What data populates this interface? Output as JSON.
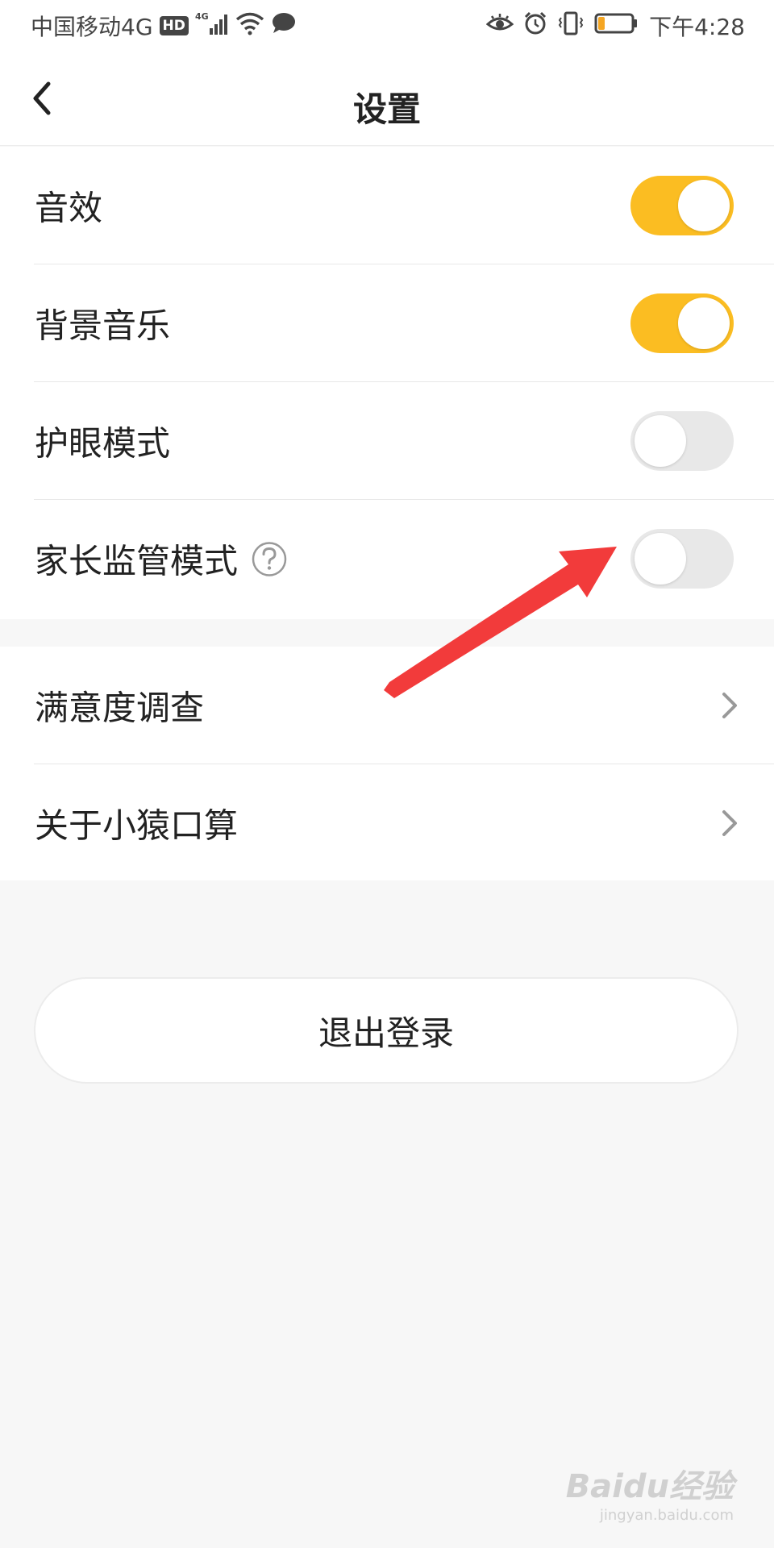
{
  "status_bar": {
    "carrier": "中国移动4G",
    "hd_badge": "HD",
    "network_type": "4G",
    "time": "下午4:28",
    "battery_level": 0.2,
    "icons": [
      "signal-icon",
      "wifi-icon",
      "message-icon",
      "eye-icon",
      "alarm-icon",
      "vibrate-icon",
      "battery-icon"
    ]
  },
  "nav": {
    "title": "设置",
    "back_icon": "back-arrow-icon"
  },
  "settings": {
    "toggles": [
      {
        "label": "音效",
        "on": true
      },
      {
        "label": "背景音乐",
        "on": true
      },
      {
        "label": "护眼模式",
        "on": false
      },
      {
        "label": "家长监管模式",
        "on": false,
        "has_help": true
      }
    ],
    "links": [
      {
        "label": "满意度调查"
      },
      {
        "label": "关于小猿口算"
      }
    ]
  },
  "logout_label": "退出登录",
  "watermark": {
    "logo": "Baidu经验",
    "url": "jingyan.baidu.com"
  },
  "colors": {
    "toggle_on": "#fbbd22",
    "toggle_off": "#e8e8e8",
    "arrow": "#f23b3b",
    "page_bg": "#f7f7f7"
  }
}
